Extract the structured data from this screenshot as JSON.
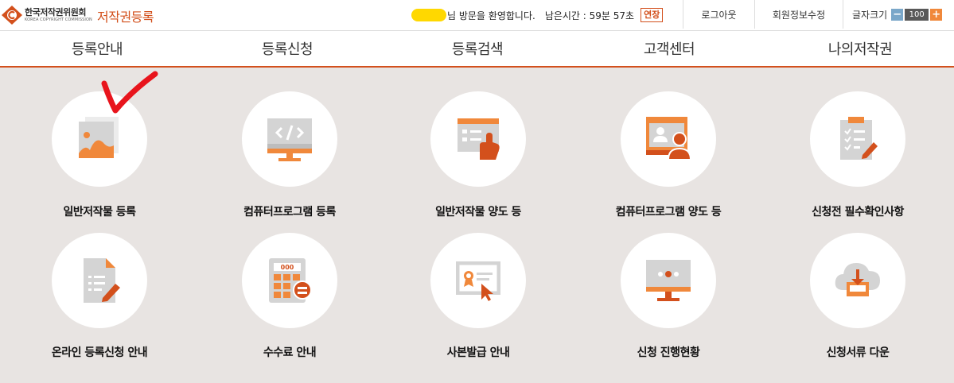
{
  "header": {
    "org_name_ko": "한국저작권위원회",
    "org_name_en": "KOREA COPYRIGHT COMMISSION",
    "site_title": "저작권등록",
    "greeting_suffix": "님 방문을 환영합니다.",
    "timer_text": "남은시간 : 59분 57초",
    "extend_label": "연장",
    "logout_label": "로그아웃",
    "edit_profile_label": "회원정보수정",
    "font_size_label": "글자크기",
    "font_size_value": "100",
    "font_minus": "−",
    "font_plus": "+"
  },
  "nav": {
    "items": [
      {
        "label": "등록안내"
      },
      {
        "label": "등록신청"
      },
      {
        "label": "등록검색"
      },
      {
        "label": "고객센터"
      },
      {
        "label": "나의저작권"
      }
    ]
  },
  "services": [
    {
      "label": "일반저작물 등록",
      "icon": "image-gallery-icon"
    },
    {
      "label": "컴퓨터프로그램 등록",
      "icon": "code-monitor-icon"
    },
    {
      "label": "일반저작물 양도 등",
      "icon": "document-handover-icon"
    },
    {
      "label": "컴퓨터프로그램 양도 등",
      "icon": "user-monitor-icon"
    },
    {
      "label": "신청전 필수확인사항",
      "icon": "checklist-clipboard-icon"
    },
    {
      "label": "온라인 등록신청 안내",
      "icon": "document-pencil-icon"
    },
    {
      "label": "수수료 안내",
      "icon": "calculator-icon"
    },
    {
      "label": "사본발급 안내",
      "icon": "certificate-icon"
    },
    {
      "label": "신청 진행현황",
      "icon": "progress-monitor-icon"
    },
    {
      "label": "신청서류 다운",
      "icon": "cloud-download-icon"
    }
  ],
  "colors": {
    "accent": "#d3501c",
    "icon_orange": "#f0883b",
    "icon_gray": "#d4d4d4",
    "background": "#e8e4e2",
    "annotation_red": "#e8141c"
  }
}
